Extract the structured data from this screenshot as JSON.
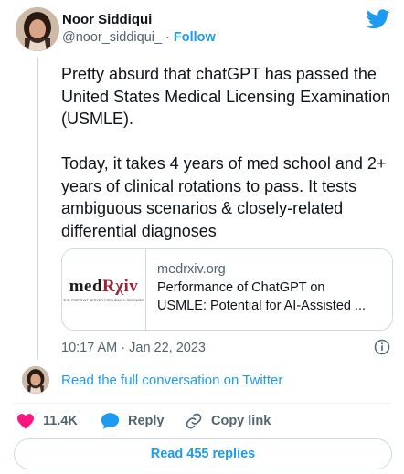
{
  "author": {
    "name": "Noor Siddiqui",
    "handle": "@noor_siddiqui_",
    "separator": "·",
    "follow_label": "Follow"
  },
  "tweet": {
    "text": "Pretty absurd that chatGPT has passed the United States Medical Licensing Examination (USMLE).\n\nToday, it takes 4 years of med school and 2+ years of clinical rotations to pass. It tests ambiguous scenarios & closely-related differential diagnoses",
    "timestamp": "10:17 AM · Jan 22, 2023"
  },
  "card": {
    "logo_text_a": "med",
    "logo_text_b": "Rχiv",
    "logo_tagline": "THE PREPRINT SERVER FOR HEALTH SCIENCES",
    "domain": "medrxiv.org",
    "title_line1": "Performance of ChatGPT on",
    "title_line2": "USMLE: Potential for AI-Assisted ..."
  },
  "conversation_link": "Read the full conversation on Twitter",
  "actions": {
    "likes": "11.4K",
    "reply_label": "Reply",
    "copy_link_label": "Copy link"
  },
  "read_replies_label": "Read 455 replies",
  "colors": {
    "accent": "#1d9bf0",
    "like": "#f91880",
    "muted": "#536471",
    "text": "#0f1419",
    "border": "#cfd9de"
  },
  "icons": [
    "twitter-bird-icon",
    "info-icon",
    "heart-icon",
    "reply-bubble-icon",
    "link-icon"
  ]
}
